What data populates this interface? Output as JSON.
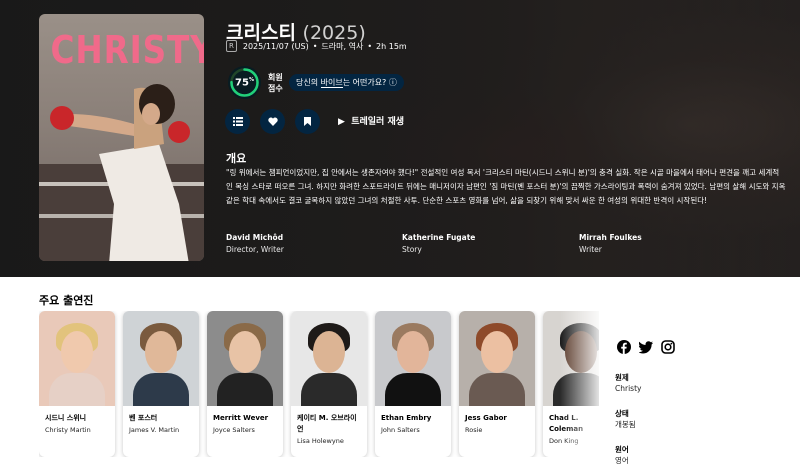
{
  "movie": {
    "poster_title": "CHRISTY",
    "title": "크리스티",
    "year": "(2025)",
    "certification": "R",
    "release": "2025/11/07 (US)",
    "genres": "드라마, 역사",
    "runtime": "2h 15m",
    "separator": "•"
  },
  "score": {
    "value": "75",
    "percent_sign": "%",
    "fraction": 0.75,
    "label_line1": "회원",
    "label_line2": "점수",
    "ring_color": "#21d07a",
    "track_color": "#204529"
  },
  "vibe": {
    "prefix": "당신의 ",
    "link": "바이브",
    "suffix": "는 어떤가요?",
    "info_icon": "ⓘ"
  },
  "actions": {
    "list_icon": "list-icon",
    "favorite_icon": "heart-icon",
    "watchlist_icon": "bookmark-icon",
    "trailer_label": "트레일러 재생"
  },
  "overview": {
    "heading": "개요",
    "text": "\"링 위에서는 챔피언이었지만, 집 안에서는 생존자여야 했다!\" 전설적인 여성 복서 '크리스티 마틴(시드니 스위니 분)'의 충격 실화. 작은 시골 마을에서 태어나 편견을 깨고 세계적인 복싱 스타로 떠오른 그녀. 하지만 화려한 스포트라이트 뒤에는 매니저이자 남편인 '짐 마틴(벤 포스터 분)'의 끔찍한 가스라이팅과 폭력이 숨겨져 있었다. 남편의 살해 시도와 지옥 같은 학대 속에서도 결코 굴복하지 않았던 그녀의 처절한 사투. 단순한 스포츠 영화를 넘어, 삶을 되찾기 위해 맞서 싸운 한 여성의 위대한 반격이 시작된다!"
  },
  "crew": [
    {
      "name": "David Michôd",
      "role": "Director, Writer"
    },
    {
      "name": "Katherine Fugate",
      "role": "Story"
    },
    {
      "name": "Mirrah Foulkes",
      "role": "Writer"
    }
  ],
  "cast_heading": "주요 출연진",
  "cast": [
    {
      "name": "시드니 스위니",
      "role": "Christy Martin",
      "bg": "#e9c9b9",
      "skin": "#f0c9ad",
      "hair": "#e2c37c",
      "cloth": "#e6d0c6"
    },
    {
      "name": "벤 포스터",
      "role": "James V. Martin",
      "bg": "#cfd3d6",
      "skin": "#e0b899",
      "hair": "#7a5a3e",
      "cloth": "#2d3a4a"
    },
    {
      "name": "Merritt Wever",
      "role": "Joyce Salters",
      "bg": "#8c8c8c",
      "skin": "#e8c3a6",
      "hair": "#8a6a48",
      "cloth": "#222222"
    },
    {
      "name": "케이티 M. 오브라이언",
      "role": "Lisa Holewyne",
      "bg": "#e7e7e7",
      "skin": "#dcb494",
      "hair": "#1e1a18",
      "cloth": "#2a2a2a"
    },
    {
      "name": "Ethan Embry",
      "role": "John Salters",
      "bg": "#c8c9cc",
      "skin": "#e2b59a",
      "hair": "#9a7a60",
      "cloth": "#111111"
    },
    {
      "name": "Jess Gabor",
      "role": "Rosie",
      "bg": "#b7b0aa",
      "skin": "#ecc0a2",
      "hair": "#8e4a2a",
      "cloth": "#6a5a52"
    },
    {
      "name": "Chad L. Coleman",
      "role": "Don King",
      "bg": "#d7d4d0",
      "skin": "#5a3a2a",
      "hair": "#1a1a1a",
      "cloth": "#2a2a2a"
    }
  ],
  "social": [
    "facebook-icon",
    "twitter-icon",
    "instagram-icon"
  ],
  "side_facts": [
    {
      "label": "원제",
      "value": "Christy"
    },
    {
      "label": "상태",
      "value": "개봉됨"
    },
    {
      "label": "원어",
      "value": "영어"
    }
  ]
}
